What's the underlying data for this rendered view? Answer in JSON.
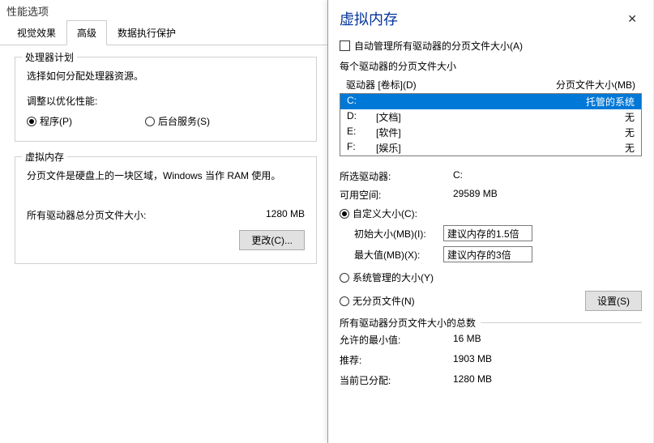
{
  "left": {
    "title": "性能选项",
    "tabs": [
      "视觉效果",
      "高级",
      "数据执行保护"
    ],
    "active_tab_index": 1,
    "processor": {
      "group_title": "处理器计划",
      "desc": "选择如何分配处理器资源。",
      "adjust_label": "调整以优化性能:",
      "radio_programs": "程序(P)",
      "radio_background": "后台服务(S)"
    },
    "vm": {
      "group_title": "虚拟内存",
      "desc": "分页文件是硬盘上的一块区域，Windows 当作 RAM 使用。",
      "total_label": "所有驱动器总分页文件大小:",
      "total_value": "1280 MB",
      "change_btn": "更改(C)..."
    }
  },
  "dialog": {
    "title": "虚拟内存",
    "auto_manage": "自动管理所有驱动器的分页文件大小(A)",
    "per_drive_label": "每个驱动器的分页文件大小",
    "header_drive": "驱动器 [卷标](D)",
    "header_size": "分页文件大小(MB)",
    "drives": [
      {
        "letter": "C:",
        "label": "",
        "size": "托管的系统",
        "selected": true
      },
      {
        "letter": "D:",
        "label": "[文档]",
        "size": "无",
        "selected": false
      },
      {
        "letter": "E:",
        "label": "[软件]",
        "size": "无",
        "selected": false
      },
      {
        "letter": "F:",
        "label": "[娱乐]",
        "size": "无",
        "selected": false
      }
    ],
    "selected_drive_label": "所选驱动器:",
    "selected_drive_value": "C:",
    "available_label": "可用空间:",
    "available_value": "29589 MB",
    "radio_custom": "自定义大小(C):",
    "initial_label": "初始大小(MB)(I):",
    "initial_value": "建议内存的1.5倍",
    "max_label": "最大值(MB)(X):",
    "max_value": "建议内存的3倍",
    "radio_system": "系统管理的大小(Y)",
    "radio_none": "无分页文件(N)",
    "set_btn": "设置(S)",
    "totals_title": "所有驱动器分页文件大小的总数",
    "min_label": "允许的最小值:",
    "min_value": "16 MB",
    "rec_label": "推荐:",
    "rec_value": "1903 MB",
    "cur_label": "当前已分配:",
    "cur_value": "1280 MB"
  }
}
